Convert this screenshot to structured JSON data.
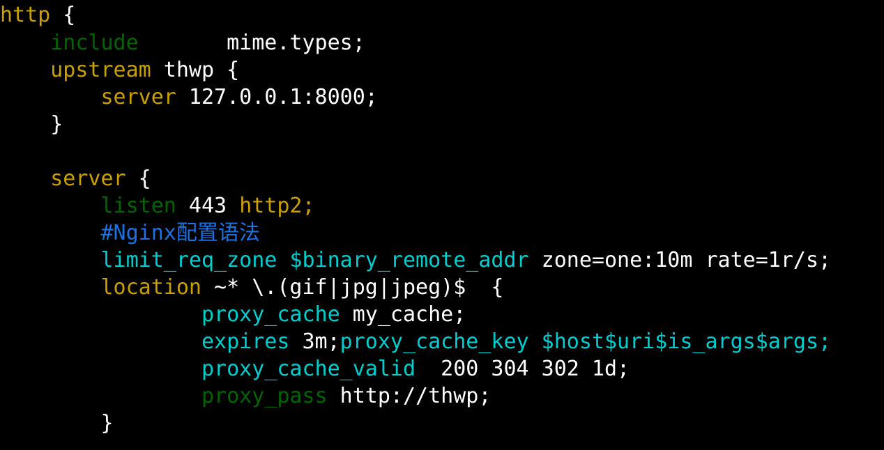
{
  "editor": {
    "background": "#000000",
    "language": "nginx",
    "colors": {
      "plain": "#ffffff",
      "keyword": "#c8a000",
      "directive": "#006400",
      "builtin": "#00cdcd",
      "comment": "#1d72e0",
      "variable": "#00cdcd"
    }
  },
  "lines": [
    {
      "id": "line-1",
      "tokens": [
        {
          "text": "http",
          "cls": "t-keyword"
        },
        {
          "text": " {",
          "cls": "t-punct"
        }
      ]
    },
    {
      "id": "line-2",
      "tokens": [
        {
          "text": "    ",
          "cls": "t-plain"
        },
        {
          "text": "include",
          "cls": "t-directive"
        },
        {
          "text": "       mime.types;",
          "cls": "t-plain"
        }
      ]
    },
    {
      "id": "line-3",
      "tokens": [
        {
          "text": "    ",
          "cls": "t-plain"
        },
        {
          "text": "upstream",
          "cls": "t-keyword"
        },
        {
          "text": " thwp {",
          "cls": "t-plain"
        }
      ]
    },
    {
      "id": "line-4",
      "tokens": [
        {
          "text": "        ",
          "cls": "t-plain"
        },
        {
          "text": "server",
          "cls": "t-keyword"
        },
        {
          "text": " 127.0.0.1:8000;",
          "cls": "t-plain"
        }
      ]
    },
    {
      "id": "line-5",
      "tokens": [
        {
          "text": "    }",
          "cls": "t-punct"
        }
      ]
    },
    {
      "id": "line-6",
      "tokens": [
        {
          "text": "",
          "cls": "t-plain"
        }
      ]
    },
    {
      "id": "line-7",
      "tokens": [
        {
          "text": "    ",
          "cls": "t-plain"
        },
        {
          "text": "server",
          "cls": "t-keyword"
        },
        {
          "text": " {",
          "cls": "t-punct"
        }
      ]
    },
    {
      "id": "line-8",
      "tokens": [
        {
          "text": "        ",
          "cls": "t-plain"
        },
        {
          "text": "listen",
          "cls": "t-directive"
        },
        {
          "text": " 443 ",
          "cls": "t-plain"
        },
        {
          "text": "http2;",
          "cls": "t-keyword"
        }
      ]
    },
    {
      "id": "line-9",
      "tokens": [
        {
          "text": "        ",
          "cls": "t-plain"
        },
        {
          "text": "#Nginx配置语法",
          "cls": "t-comment"
        }
      ]
    },
    {
      "id": "line-10",
      "tokens": [
        {
          "text": "        ",
          "cls": "t-plain"
        },
        {
          "text": "limit_req_zone",
          "cls": "t-builtin"
        },
        {
          "text": " ",
          "cls": "t-plain"
        },
        {
          "text": "$binary_remote_addr",
          "cls": "t-var"
        },
        {
          "text": " zone=one:10m rate=1r/s;",
          "cls": "t-plain"
        }
      ]
    },
    {
      "id": "line-11",
      "tokens": [
        {
          "text": "        ",
          "cls": "t-plain"
        },
        {
          "text": "location",
          "cls": "t-keyword"
        },
        {
          "text": " ~* \\.(gif|jpg|jpeg)$  {",
          "cls": "t-plain"
        }
      ]
    },
    {
      "id": "line-12",
      "tokens": [
        {
          "text": "                ",
          "cls": "t-plain"
        },
        {
          "text": "proxy_cache",
          "cls": "t-builtin"
        },
        {
          "text": " my_cache;",
          "cls": "t-plain"
        }
      ]
    },
    {
      "id": "line-13",
      "tokens": [
        {
          "text": "                ",
          "cls": "t-plain"
        },
        {
          "text": "expires",
          "cls": "t-builtin"
        },
        {
          "text": " 3m;",
          "cls": "t-plain"
        },
        {
          "text": "proxy_cache_key",
          "cls": "t-builtin"
        },
        {
          "text": " ",
          "cls": "t-plain"
        },
        {
          "text": "$host$uri$is_args$args;",
          "cls": "t-var"
        }
      ]
    },
    {
      "id": "line-14",
      "tokens": [
        {
          "text": "                ",
          "cls": "t-plain"
        },
        {
          "text": "proxy_cache_valid",
          "cls": "t-builtin"
        },
        {
          "text": "  200 304 302 1d;",
          "cls": "t-plain"
        }
      ]
    },
    {
      "id": "line-15",
      "tokens": [
        {
          "text": "                ",
          "cls": "t-plain"
        },
        {
          "text": "proxy_pass",
          "cls": "t-directive"
        },
        {
          "text": " http://thwp;",
          "cls": "t-plain"
        }
      ]
    },
    {
      "id": "line-16",
      "tokens": [
        {
          "text": "        }",
          "cls": "t-punct"
        }
      ]
    }
  ]
}
